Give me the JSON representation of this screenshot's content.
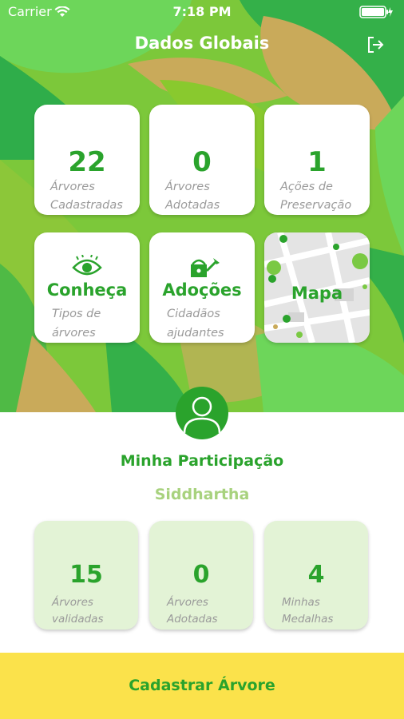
{
  "status_bar": {
    "carrier": "Carrier",
    "time": "7:18 PM"
  },
  "header": {
    "title": "Dados Globais",
    "logout_icon": "logout-icon"
  },
  "global_stats": [
    {
      "value": "22",
      "label_line1": "Árvores",
      "label_line2": "Cadastradas"
    },
    {
      "value": "0",
      "label_line1": "Árvores",
      "label_line2": "Adotadas"
    },
    {
      "value": "1",
      "label_line1": "Ações de",
      "label_line2": "Preservação"
    }
  ],
  "nav_cards": [
    {
      "title": "Conheça",
      "label_line1": "Tipos de",
      "label_line2": "árvores",
      "icon": "eye-icon"
    },
    {
      "title": "Adoções",
      "label_line1": "Cidadãos",
      "label_line2": "ajudantes",
      "icon": "watering-can-icon"
    },
    {
      "title": "Mapa",
      "icon": "map-icon"
    }
  ],
  "participation": {
    "title": "Minha Participação",
    "user_name": "Siddhartha",
    "stats": [
      {
        "value": "15",
        "label_line1": "Árvores",
        "label_line2": "validadas"
      },
      {
        "value": "0",
        "label_line1": "Árvores",
        "label_line2": "Adotadas"
      },
      {
        "value": "4",
        "label_line1": "Minhas",
        "label_line2": "Medalhas"
      }
    ]
  },
  "cta": {
    "label": "Cadastrar Árvore"
  },
  "colors": {
    "primary_green": "#2aa32c",
    "light_green": "#a8d27e",
    "card_tint": "#e3f3d6",
    "cta_yellow": "#fbe24b"
  }
}
